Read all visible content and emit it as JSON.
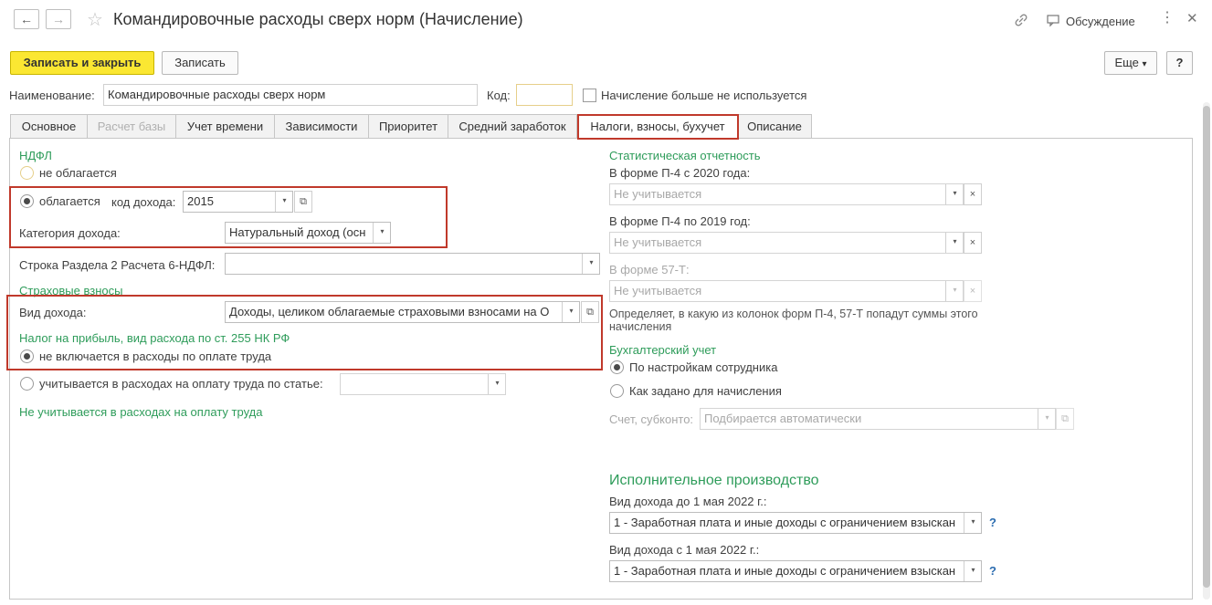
{
  "window": {
    "title": "Командировочные расходы сверх норм (Начисление)",
    "discussion_label": "Обсуждение"
  },
  "toolbar": {
    "save_close": "Записать и закрыть",
    "save": "Записать",
    "more": "Еще",
    "help": "?"
  },
  "header": {
    "name_label": "Наименование:",
    "name_value": "Командировочные расходы сверх норм",
    "code_label": "Код:",
    "code_value": "",
    "unused_label": "Начисление больше не используется"
  },
  "tabs": [
    {
      "label": "Основное",
      "state": "normal"
    },
    {
      "label": "Расчет базы",
      "state": "disabled"
    },
    {
      "label": "Учет времени",
      "state": "normal"
    },
    {
      "label": "Зависимости",
      "state": "normal"
    },
    {
      "label": "Приоритет",
      "state": "normal"
    },
    {
      "label": "Средний заработок",
      "state": "normal"
    },
    {
      "label": "Налоги, взносы, бухучет",
      "state": "active"
    },
    {
      "label": "Описание",
      "state": "normal"
    }
  ],
  "left": {
    "ndfl_title": "НДФЛ",
    "not_taxed": "не облагается",
    "taxed": "облагается",
    "income_code_label": "код дохода:",
    "income_code_value": "2015",
    "income_category_label": "Категория дохода:",
    "income_category_value": "Натуральный доход (осн",
    "section_row_label": "Строка Раздела 2 Расчета 6-НДФЛ:",
    "section_row_value": "",
    "insurance_title": "Страховые взносы",
    "income_type_label": "Вид дохода:",
    "income_type_value": "Доходы, целиком облагаемые страховыми взносами на О",
    "profit_tax_title": "Налог на прибыль, вид расхода по ст. 255 НК РФ",
    "not_included": "не включается в расходы по оплате труда",
    "included_by_article": "учитывается в расходах на оплату труда по статье:",
    "included_article_value": "",
    "not_counted_note": "Не учитывается в расходах на оплату труда"
  },
  "right": {
    "stat_title": "Статистическая отчетность",
    "p4_2020_label": "В форме П-4 с 2020 года:",
    "p4_2020_value": "Не учитывается",
    "p4_2019_label": "В форме П-4 по 2019 год:",
    "p4_2019_value": "Не учитывается",
    "f57_label": "В форме 57-Т:",
    "f57_value": "Не учитывается",
    "stat_note": "Определяет, в какую из колонок форм П-4, 57-Т попадут суммы этого начисления",
    "acc_title": "Бухгалтерский учет",
    "acc_by_employee": "По настройкам сотрудника",
    "acc_as_set": "Как задано для начисления",
    "account_label": "Счет, субконто:",
    "account_value": "Подбирается автоматически",
    "enforcement_title": "Исполнительное производство",
    "before_label": "Вид дохода до 1 мая 2022 г.:",
    "before_value": "1 - Заработная плата и иные доходы с ограничением взыскан",
    "after_label": "Вид дохода с 1 мая 2022 г.:",
    "after_value": "1 - Заработная плата и иные доходы с ограничением взыскан",
    "help_mark": "?"
  },
  "icons": {
    "back": "←",
    "forward": "→",
    "star": "☆",
    "link": "🔗",
    "discussion": "▭",
    "kebab": "⋮",
    "close": "✕",
    "dropdown": "▾",
    "open": "⧉",
    "clear": "×"
  },
  "colors": {
    "accent_green": "#2e9c5a",
    "primary_button": "#fbe732",
    "highlight_red": "#c0392b"
  }
}
